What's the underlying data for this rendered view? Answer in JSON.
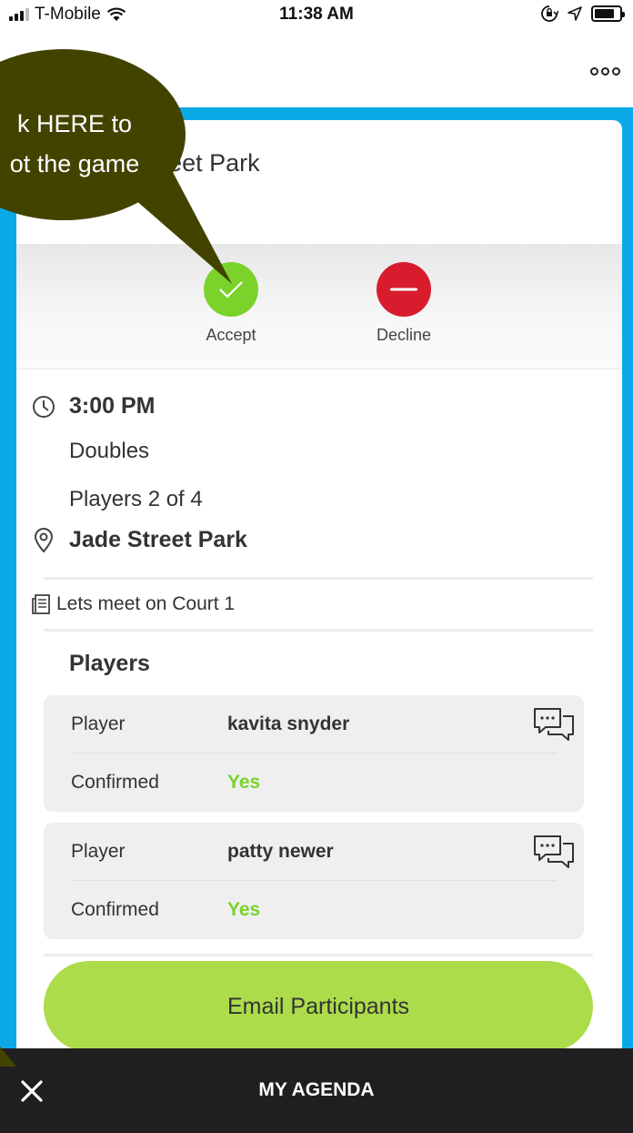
{
  "status_bar": {
    "carrier": "T-Mobile",
    "time": "11:38 AM",
    "battery_level": 0.8
  },
  "tutorial": {
    "line1": "k HERE to",
    "line2": "ot the game",
    "bubble_color": "#434300"
  },
  "event": {
    "title": "ade Street Park",
    "rsvp": {
      "accept_label": "Accept",
      "decline_label": "Decline"
    },
    "time": "3:00 PM",
    "format": "Doubles",
    "players_count": "Players 2 of 4",
    "location": "Jade Street Park",
    "notes": "Lets meet on Court 1"
  },
  "players": {
    "heading": "Players",
    "list": [
      {
        "role_label": "Player",
        "name": "kavita snyder",
        "confirmed_label": "Confirmed",
        "confirmed_value": "Yes"
      },
      {
        "role_label": "Player",
        "name": "patty newer",
        "confirmed_label": "Confirmed",
        "confirmed_value": "Yes"
      }
    ]
  },
  "actions": {
    "email_label": "Email Participants"
  },
  "agenda_bar": {
    "title": "MY AGENDA"
  },
  "colors": {
    "frame_blue": "#0ba8e6",
    "accept_green": "#7ad22b",
    "decline_red": "#d81c2e",
    "email_button": "#acdc4a",
    "agenda_bar": "#1f1f1f"
  },
  "icons": [
    "signal-icon",
    "wifi-icon",
    "orientation-lock-icon",
    "location-arrow-icon",
    "battery-icon",
    "more-icon",
    "check-icon",
    "minus-icon",
    "clock-icon",
    "location-pin-icon",
    "notes-icon",
    "chat-icon",
    "close-icon"
  ]
}
